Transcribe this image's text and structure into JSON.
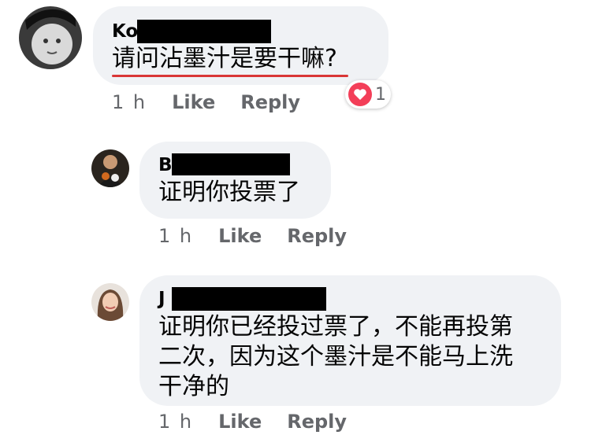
{
  "comments": [
    {
      "author": "Ko",
      "text": "请问沾墨汁是要干嘛?",
      "time": "1 h",
      "like": "Like",
      "reply": "Reply",
      "reaction_count": "1",
      "reaction_icon": "heart-icon"
    },
    {
      "author": "B",
      "text": "证明你投票了",
      "time": "1 h",
      "like": "Like",
      "reply": "Reply"
    },
    {
      "author": "J",
      "text": "证明你已经投过票了，不能再投第\n二次，因为这个墨汁是不能马上洗\n干净的",
      "time": "1 h",
      "like": "Like",
      "reply": "Reply"
    }
  ],
  "colors": {
    "bubble": "#f0f2f5",
    "meta_text": "#65676b",
    "underline": "#d93636",
    "heart": "#f33e58"
  }
}
